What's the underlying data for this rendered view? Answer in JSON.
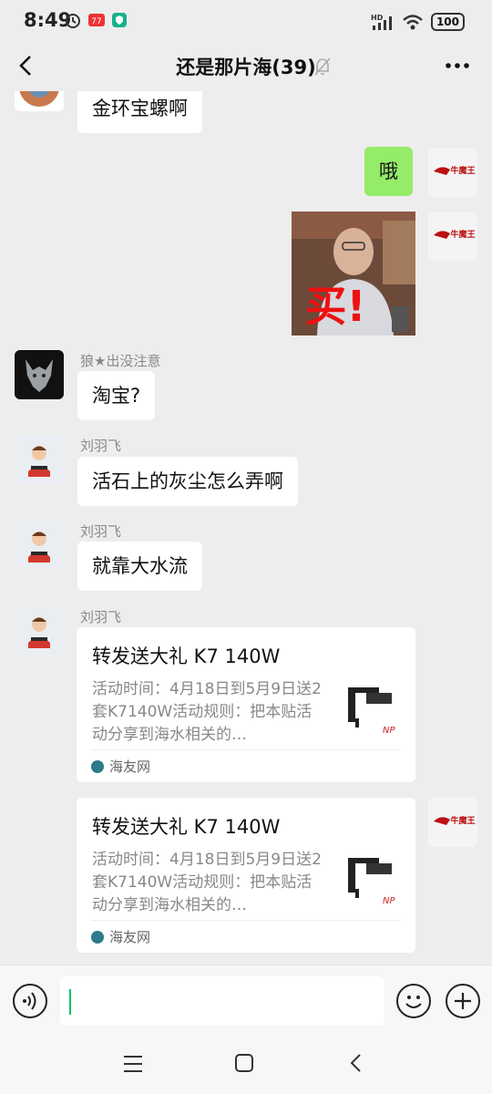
{
  "status_bar": {
    "time": "8:49",
    "network": "HD",
    "battery": "100"
  },
  "header": {
    "title": "还是那片海(39)"
  },
  "messages": [
    {
      "kind": "text",
      "side": "left",
      "sender": "",
      "text": "金环宝螺啊"
    },
    {
      "kind": "text",
      "side": "right",
      "text": "哦",
      "avatar_label": "牛魔王"
    },
    {
      "kind": "image",
      "side": "right",
      "image_text": "买!",
      "avatar_label": "牛魔王"
    },
    {
      "kind": "text",
      "side": "left",
      "sender": "狼★出没注意",
      "text": "淘宝?"
    },
    {
      "kind": "text",
      "side": "left",
      "sender": "刘羽飞",
      "text": "活石上的灰尘怎么弄啊"
    },
    {
      "kind": "text",
      "side": "left",
      "sender": "刘羽飞",
      "text": "就靠大水流"
    },
    {
      "kind": "card",
      "side": "left",
      "sender": "刘羽飞",
      "title": "转发送大礼 K7 140W",
      "desc": "活动时间：4月18日到5月9日送2套K7140W活动规则：把本贴活动分享到海水相关的…",
      "source": "海友网"
    },
    {
      "kind": "card",
      "side": "right",
      "avatar_label": "牛魔王",
      "title": "转发送大礼 K7 140W",
      "desc": "活动时间：4月18日到5月9日送2套K7140W活动规则：把本贴活动分享到海水相关的…",
      "source": "海友网"
    }
  ],
  "colors": {
    "my_bubble": "#95ec69",
    "background": "#ededed",
    "accent": "#07c160"
  }
}
